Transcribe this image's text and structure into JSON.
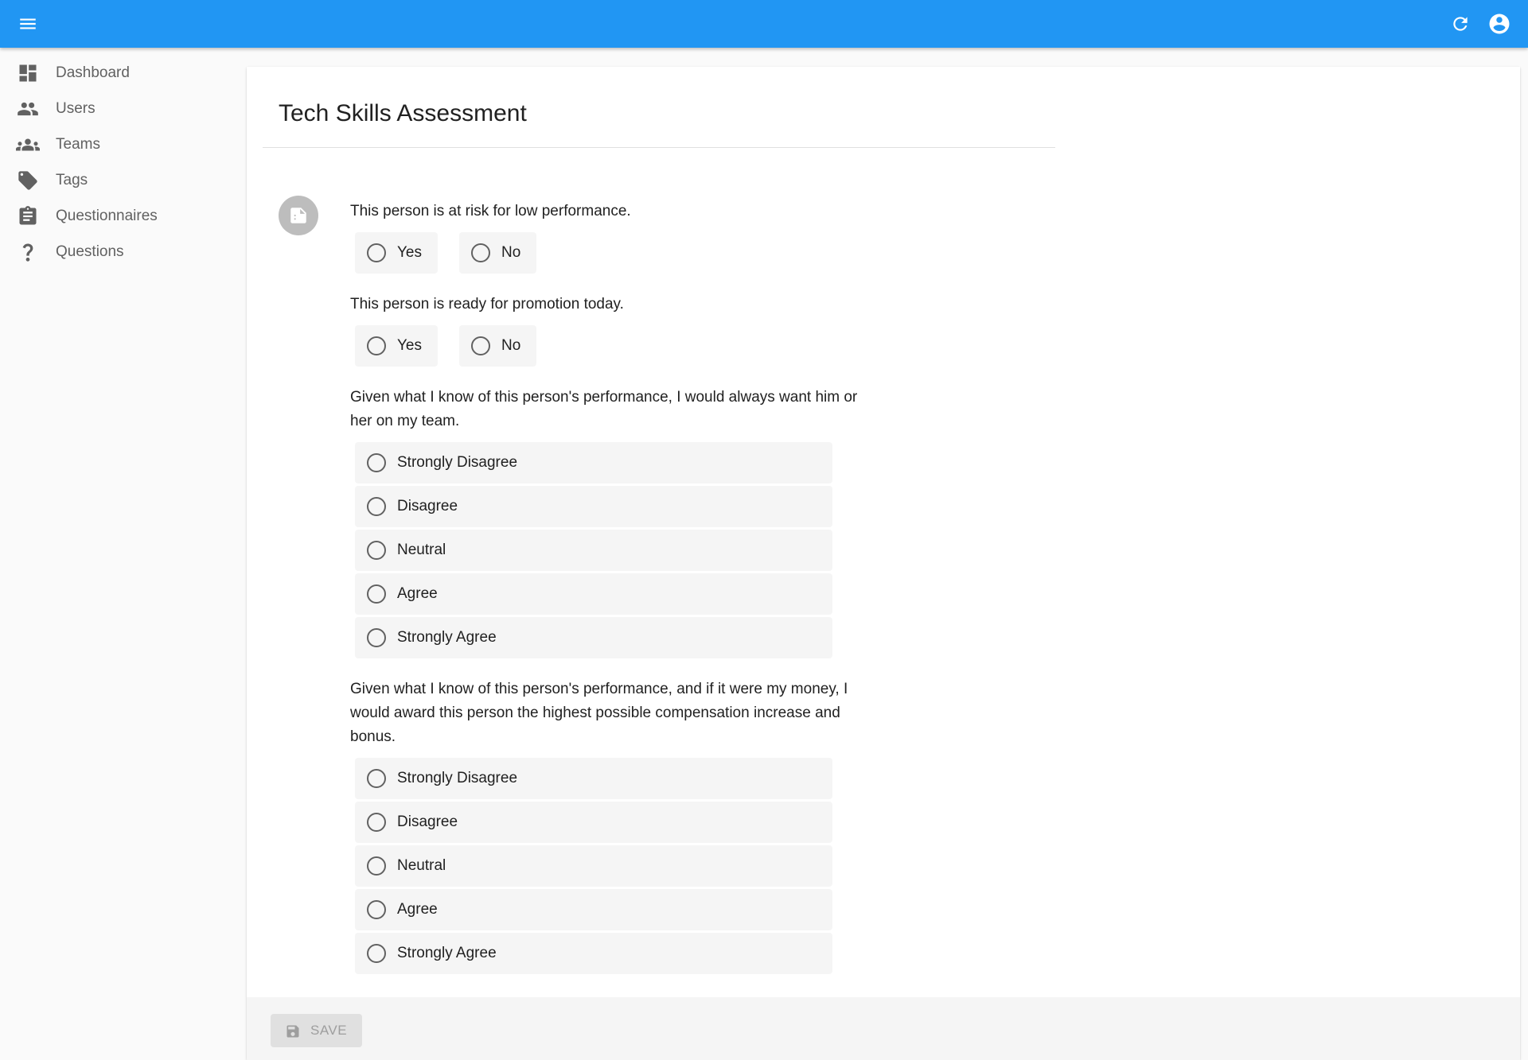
{
  "appbar": {
    "menu_icon": "menu-icon",
    "refresh_icon": "refresh-icon",
    "account_icon": "account-circle-icon",
    "color": "#2196f3"
  },
  "sidebar": {
    "items": [
      {
        "label": "Dashboard",
        "icon": "dashboard-icon"
      },
      {
        "label": "Users",
        "icon": "users-icon"
      },
      {
        "label": "Teams",
        "icon": "teams-icon"
      },
      {
        "label": "Tags",
        "icon": "tag-icon"
      },
      {
        "label": "Questionnaires",
        "icon": "clipboard-icon"
      },
      {
        "label": "Questions",
        "icon": "question-mark-icon"
      }
    ]
  },
  "form": {
    "title": "Tech Skills Assessment",
    "avatar_icon": "note-icon",
    "questions": [
      {
        "text": "This person is at risk for low performance.",
        "options": [
          "Yes",
          "No"
        ]
      },
      {
        "text": "This person is ready for promotion today.",
        "options": [
          "Yes",
          "No"
        ]
      },
      {
        "text": "Given what I know of this person's performance, I would always want him or her on my team.",
        "options": [
          "Strongly Disagree",
          "Disagree",
          "Neutral",
          "Agree",
          "Strongly Agree"
        ]
      },
      {
        "text": "Given what I know of this person's performance, and if it were my money, I would award this person the highest possible compensation increase and bonus.",
        "options": [
          "Strongly Disagree",
          "Disagree",
          "Neutral",
          "Agree",
          "Strongly Agree"
        ]
      }
    ],
    "save_label": "SAVE",
    "save_icon": "floppy-disk-icon"
  }
}
